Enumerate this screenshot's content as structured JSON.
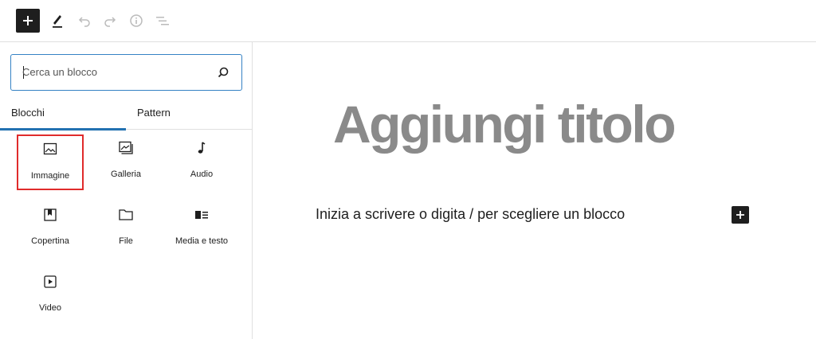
{
  "toolbar": {
    "buttons": [
      {
        "name": "add-block-button",
        "icon": "plus-icon"
      },
      {
        "name": "tools-button",
        "icon": "pencil-icon"
      },
      {
        "name": "undo-button",
        "icon": "undo-icon"
      },
      {
        "name": "redo-button",
        "icon": "redo-icon"
      },
      {
        "name": "details-button",
        "icon": "info-icon"
      },
      {
        "name": "list-view-button",
        "icon": "list-view-icon"
      }
    ]
  },
  "inserter": {
    "search": {
      "placeholder": "Cerca un blocco",
      "value": ""
    },
    "tabs": [
      {
        "label": "Blocchi",
        "active": true
      },
      {
        "label": "Pattern",
        "active": false
      }
    ],
    "blocks": [
      {
        "label": "Immagine",
        "icon": "image-icon",
        "selected": true
      },
      {
        "label": "Galleria",
        "icon": "gallery-icon",
        "selected": false
      },
      {
        "label": "Audio",
        "icon": "audio-icon",
        "selected": false
      },
      {
        "label": "Copertina",
        "icon": "cover-icon",
        "selected": false
      },
      {
        "label": "File",
        "icon": "folder-icon",
        "selected": false
      },
      {
        "label": "Media e testo",
        "icon": "media-text-icon",
        "selected": false
      },
      {
        "label": "Video",
        "icon": "video-icon",
        "selected": false
      }
    ]
  },
  "editor": {
    "title_placeholder": "Aggiungi titolo",
    "paragraph_placeholder": "Inizia a scrivere o digita / per scegliere un blocco"
  },
  "colors": {
    "accent": "#2271b1",
    "dark": "#1e1e1e",
    "highlight": "#e02b2b",
    "title": "#8a8a8a"
  }
}
